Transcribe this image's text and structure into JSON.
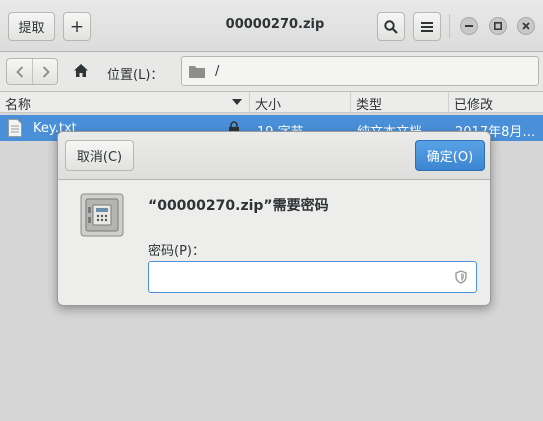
{
  "header": {
    "extract_label": "提取",
    "add_label": "+",
    "title": "00000270.zip"
  },
  "toolbar": {
    "location_label": "位置(L)：",
    "path": "/"
  },
  "columns": {
    "name": "名称",
    "size": "大小",
    "type": "类型",
    "modified": "已修改"
  },
  "files": [
    {
      "name": "Key.txt",
      "size": "19 字节",
      "type": "纯文本文档",
      "modified": "2017年8月…"
    }
  ],
  "dialog": {
    "cancel_label": "取消(C)",
    "ok_label": "确定(O)",
    "heading": "“00000270.zip”需要密码",
    "password_label": "密码(P)：",
    "password_value": ""
  },
  "colors": {
    "accent": "#4a90d9",
    "selected_row": "#4a90d9"
  }
}
